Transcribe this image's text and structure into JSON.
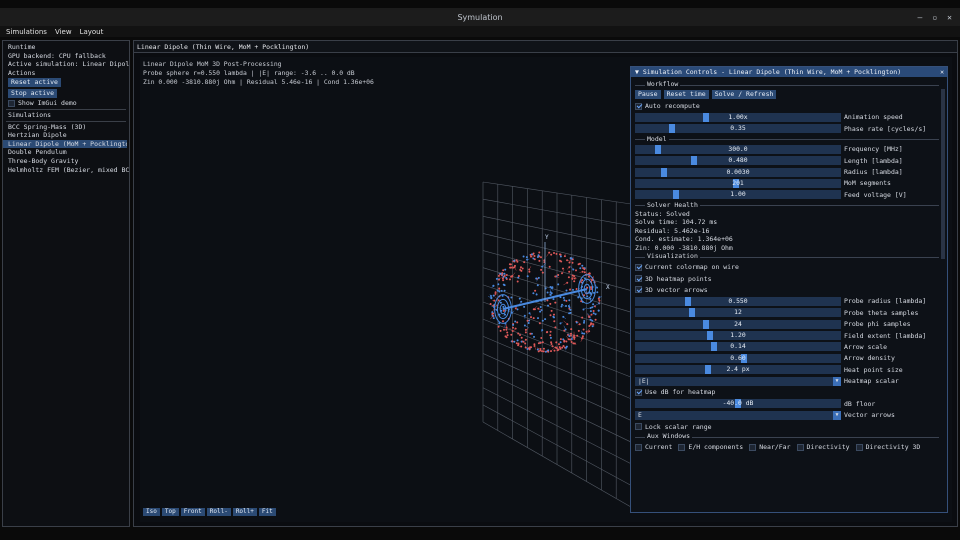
{
  "window": {
    "title": "Symulation",
    "controls": [
      "–",
      "▫",
      "✕"
    ]
  },
  "menu": [
    "Simulations",
    "View",
    "Layout"
  ],
  "left": {
    "runtime_header": "Runtime",
    "gpu_backend": "GPU backend: CPU fallback",
    "active_sim": "Active simulation: Linear Dipole (M",
    "actions_header": "Actions",
    "reset_active": "Reset active",
    "stop_active": "Stop active",
    "show_demo": "Show ImGui demo",
    "simulations_header": "Simulations",
    "simulations": [
      "BCC Spring-Mass (3D)",
      "Hertzian Dipole",
      "Linear Dipole (MoM + Pocklington)",
      "Double Pendulum",
      "Three-Body Gravity",
      "Helmholtz FEM (Bezier, mixed BC)"
    ],
    "selected_index": 2
  },
  "main": {
    "title": "Linear Dipole (Thin Wire, MoM + Pocklington)",
    "info1": "Linear Dipole MoM 3D Post-Processing",
    "info2": "Probe sphere r=0.550 lambda | |E| range: -3.6 .. 0.0 dB",
    "info3": "Zin 0.000 -3810.880j Ohm | Residual 5.46e-16 | Cond 1.36e+06",
    "axis_y": "Y",
    "axis_x": "X",
    "view_buttons": [
      "Iso",
      "Top",
      "Front",
      "Roll-",
      "Roll+",
      "Fit"
    ]
  },
  "ctrl": {
    "title": "Simulation Controls - Linear Dipole (Thin Wire, MoM + Pocklington)",
    "workflow": "Workflow",
    "pause": "Pause",
    "reset_time": "Reset time",
    "solve": "Solve / Refresh",
    "auto_recompute": "Auto recompute",
    "anim_speed": {
      "value": "1.00x",
      "label": "Animation speed",
      "frac": 0.34
    },
    "phase_rate": {
      "value": "0.35",
      "label": "Phase rate [cycles/s]",
      "frac": 0.17
    },
    "model": "Model",
    "frequency": {
      "value": "300.0",
      "label": "Frequency [MHz]",
      "frac": 0.1
    },
    "length": {
      "value": "0.480",
      "label": "Length [lambda]",
      "frac": 0.28
    },
    "radius": {
      "value": "0.0030",
      "label": "Radius [lambda]",
      "frac": 0.13
    },
    "mom_segments": {
      "value": "201",
      "label": "MoM segments",
      "frac": 0.49
    },
    "feed_voltage": {
      "value": "1.00",
      "label": "Feed voltage [V]",
      "frac": 0.19
    },
    "solver_health": "Solver Health",
    "status": "Status: Solved",
    "solve_time": "Solve time: 104.72 ms",
    "residual": "Residual: 5.462e-16",
    "cond": "Cond. estimate: 1.364e+06",
    "zin": "Zin: 0.000 -3810.880j Ohm",
    "visualization": "Visualization",
    "current_colormap": "Current colormap on wire",
    "heatmap_points": "3D heatmap points",
    "vector_arrows": "3D vector arrows",
    "probe_radius": {
      "value": "0.550",
      "label": "Probe radius [lambda]",
      "frac": 0.25
    },
    "probe_theta": {
      "value": "12",
      "label": "Probe theta samples",
      "frac": 0.27
    },
    "probe_phi": {
      "value": "24",
      "label": "Probe phi samples",
      "frac": 0.34
    },
    "field_extent": {
      "value": "1.20",
      "label": "Field extent [lambda]",
      "frac": 0.36
    },
    "arrow_scale": {
      "value": "0.14",
      "label": "Arrow scale",
      "frac": 0.38
    },
    "arrow_density": {
      "value": "0.60",
      "label": "Arrow density",
      "frac": 0.53
    },
    "heat_point_size": {
      "value": "2.4 px",
      "label": "Heat point size",
      "frac": 0.35
    },
    "heatmap_scalar_value": "|E|",
    "heatmap_scalar_label": "Heatmap scalar",
    "use_db": "Use dB for heatmap",
    "db_floor": {
      "value": "-40.0 dB",
      "label": "dB floor",
      "frac": 0.5
    },
    "vector_arrows_value": "E",
    "vector_arrows_label": "Vector arrows",
    "lock_scalar": "Lock scalar range",
    "aux": "Aux Windows",
    "aux_items": [
      "Current",
      "E/H components",
      "Near/Far",
      "Directivity",
      "Directivity 3D"
    ]
  },
  "colors": {
    "accent": "#2b4a74",
    "grab": "#4a8ae0",
    "field_red": "#e05a5a",
    "field_blue": "#4a8ae0"
  }
}
